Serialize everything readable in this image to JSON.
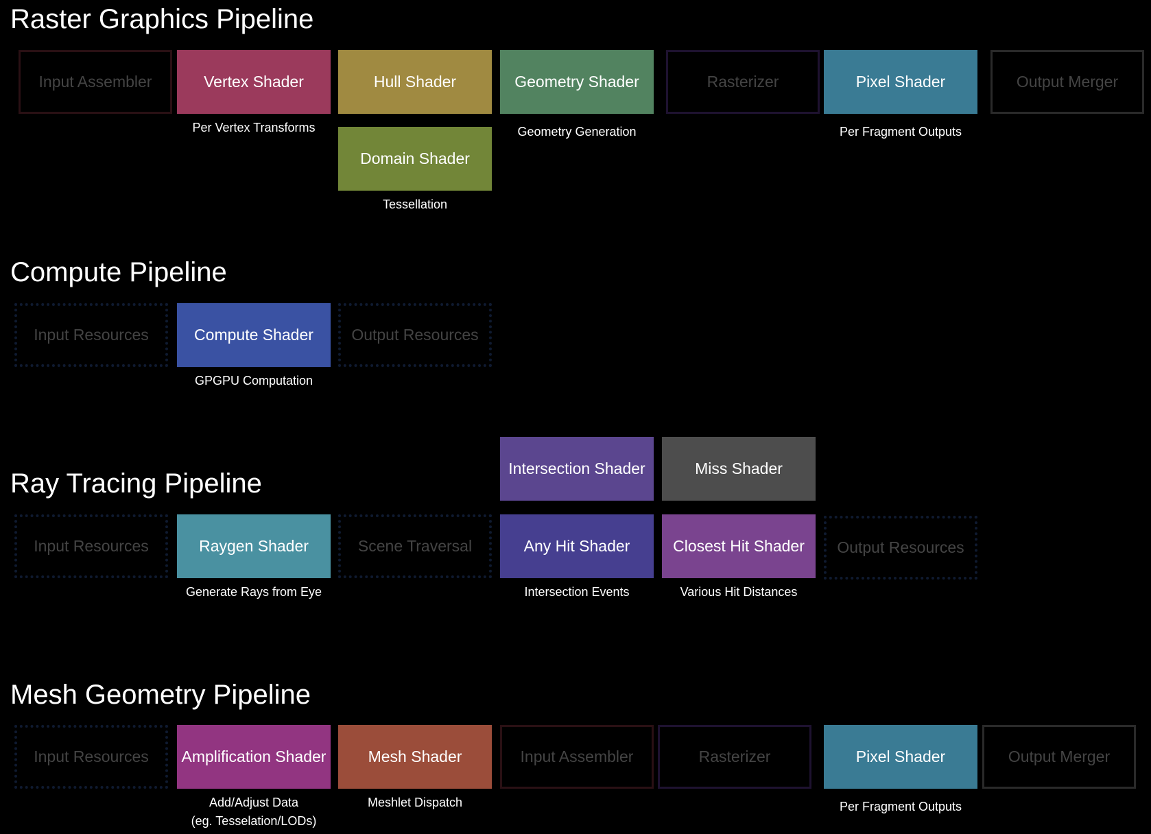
{
  "colors": {
    "background": "#000000",
    "vertex": "#9b3a5c",
    "hull": "#a08a41",
    "domain": "#728638",
    "geometry": "#528360",
    "pixel": "#3a7b94",
    "compute": "#3a52a3",
    "raygen": "#4a91a1",
    "intersection": "#5b468f",
    "miss": "#4d4d4d",
    "any_hit": "#463f90",
    "closest_hit": "#7a448f",
    "amplification": "#923581",
    "mesh": "#9b4d3a",
    "outline_red": "#2a1014",
    "outline_purple": "#1e1230",
    "outline_gray": "#2a2a2a"
  },
  "raster": {
    "title": "Raster Graphics Pipeline",
    "input_assembler": "Input Assembler",
    "vertex_shader": "Vertex Shader",
    "vertex_caption": "Per Vertex Transforms",
    "hull_shader": "Hull Shader",
    "domain_shader": "Domain Shader",
    "tessellation_caption": "Tessellation",
    "geometry_shader": "Geometry Shader",
    "geometry_caption": "Geometry Generation",
    "rasterizer": "Rasterizer",
    "pixel_shader": "Pixel Shader",
    "pixel_caption": "Per Fragment Outputs",
    "output_merger": "Output Merger"
  },
  "compute": {
    "title": "Compute Pipeline",
    "input_resources": "Input Resources",
    "compute_shader": "Compute Shader",
    "compute_caption": "GPGPU Computation",
    "output_resources": "Output Resources"
  },
  "ray": {
    "title": "Ray Tracing Pipeline",
    "input_resources": "Input Resources",
    "raygen_shader": "Raygen Shader",
    "raygen_caption": "Generate Rays from Eye",
    "scene_traversal": "Scene Traversal",
    "intersection_shader": "Intersection Shader",
    "miss_shader": "Miss Shader",
    "any_hit_shader": "Any Hit Shader",
    "any_hit_caption": "Intersection Events",
    "closest_hit_shader": "Closest Hit Shader",
    "closest_hit_caption": "Various Hit Distances",
    "output_resources": "Output Resources"
  },
  "mesh": {
    "title": "Mesh Geometry Pipeline",
    "input_resources": "Input Resources",
    "amplification_shader": "Amplification Shader",
    "amplification_caption_1": "Add/Adjust Data",
    "amplification_caption_2": "(eg. Tesselation/LODs)",
    "mesh_shader": "Mesh Shader",
    "mesh_caption": "Meshlet Dispatch",
    "input_assembler": "Input Assembler",
    "rasterizer": "Rasterizer",
    "pixel_shader": "Pixel Shader",
    "pixel_caption": "Per Fragment Outputs",
    "output_merger": "Output Merger"
  }
}
